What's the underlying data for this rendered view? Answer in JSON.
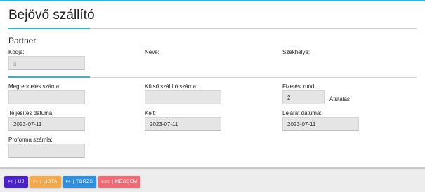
{
  "page": {
    "title": "Bejövő szállító"
  },
  "partner": {
    "section_title": "Partner",
    "code_label": "Kódja:",
    "code_value": "",
    "name_label": "Neve:",
    "seat_label": "Székhelye:"
  },
  "details": {
    "order_number_label": "Megrendelés száma:",
    "order_number_value": "",
    "external_number_label": "Külső szállító száma:",
    "external_number_value": "",
    "payment_method_label": "Fizetési mód:",
    "payment_method_value": "2",
    "payment_method_name": "Átutalás",
    "completion_date_label": "Teljesítés dátuma:",
    "completion_date_value": "2023-07-11",
    "issue_date_label": "Kelt:",
    "issue_date_value": "2023-07-11",
    "due_date_label": "Lejárat dátuma:",
    "due_date_value": "2023-07-11",
    "proforma_label": "Proforma számla:",
    "proforma_value": ""
  },
  "footer": {
    "new_key": "F2",
    "new_label": "| ÚJ",
    "list_key": "F3",
    "list_label": "| LISTA",
    "master_key": "F4",
    "master_label": "| TÖRZS",
    "cancel_key": "ESC",
    "cancel_label": "| MÉGSEM"
  },
  "colors": {
    "accent": "#29b6d8",
    "new_button": "#4a22c8",
    "list_button": "#f1a94a",
    "master_button": "#2f8fe0",
    "cancel_button": "#ef6a74"
  }
}
